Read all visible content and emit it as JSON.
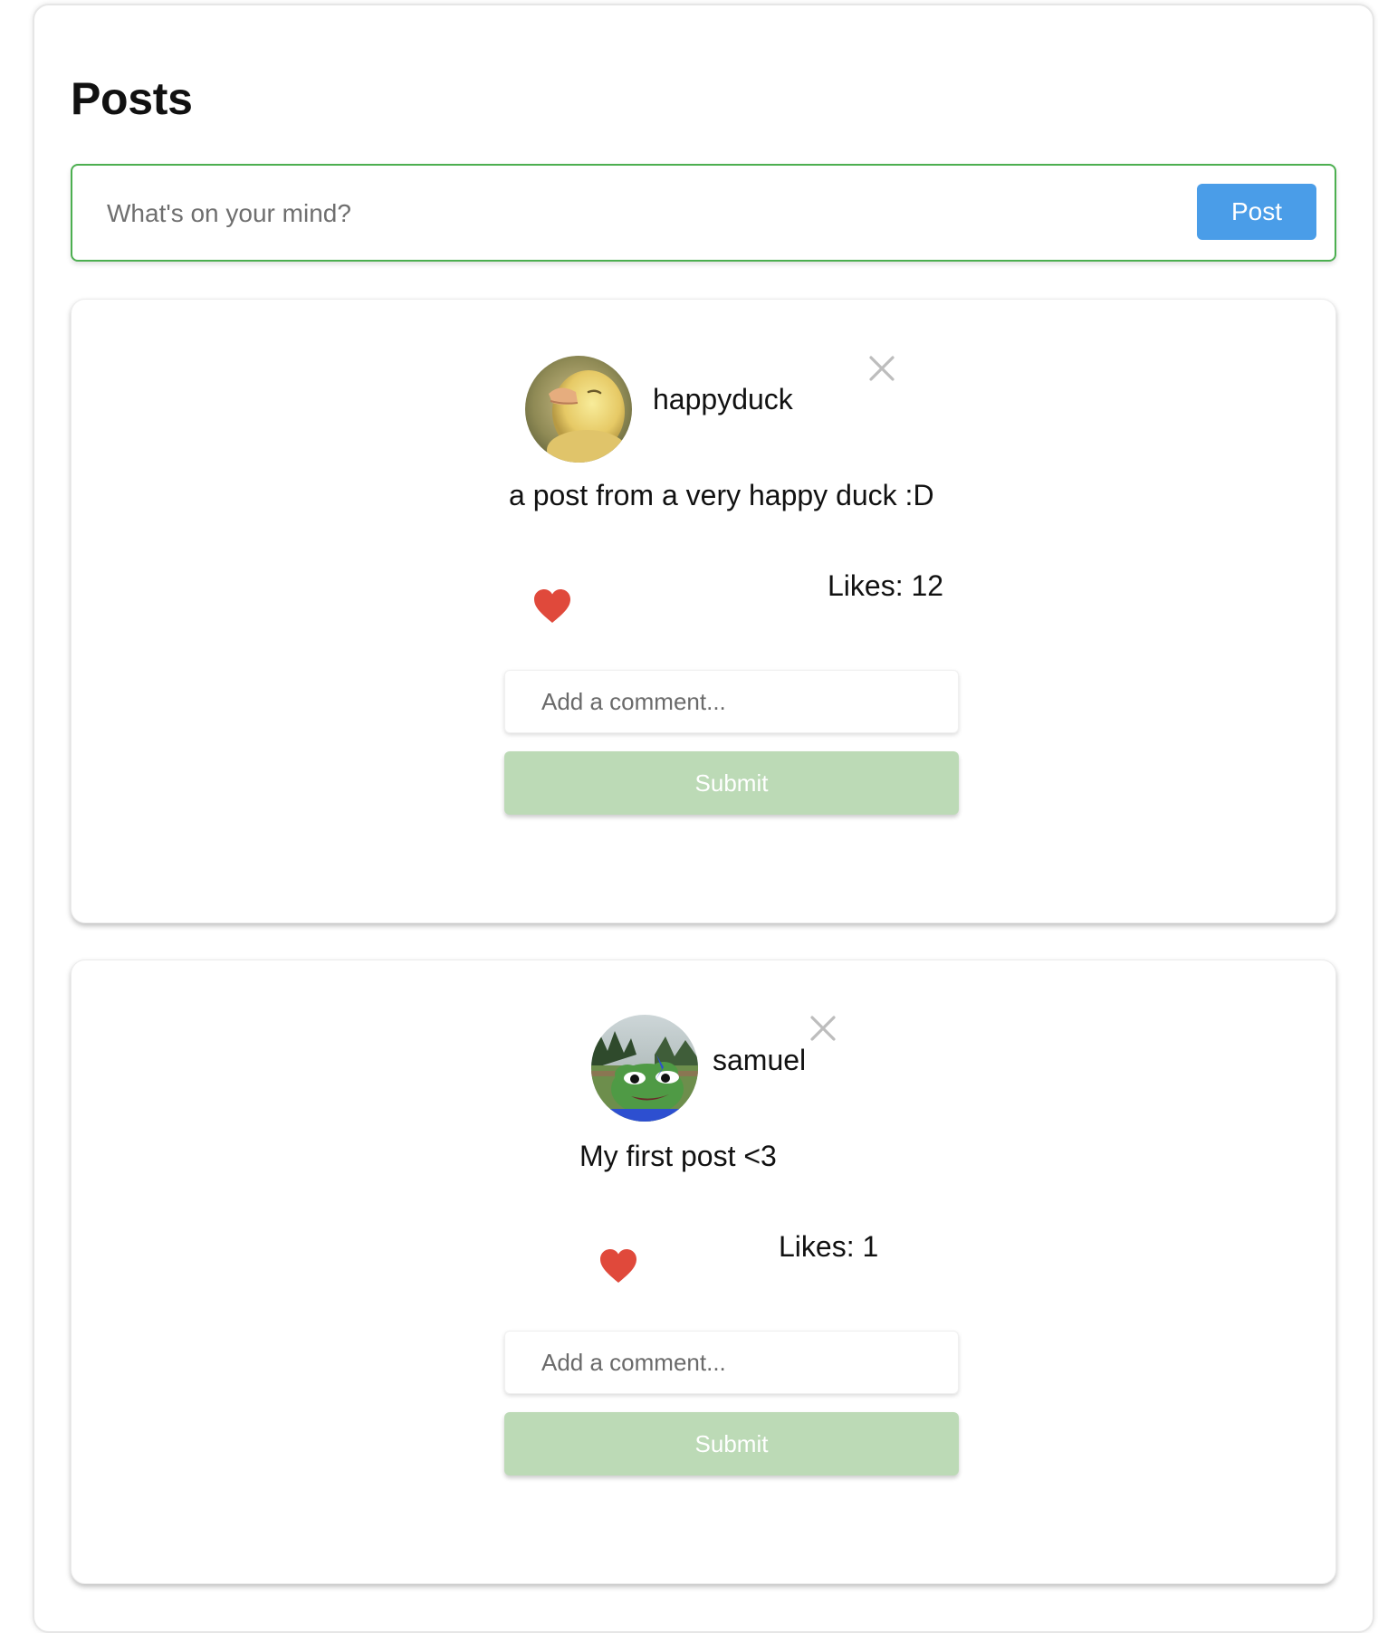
{
  "page": {
    "title": "Posts"
  },
  "composer": {
    "placeholder": "What's on your mind?",
    "post_label": "Post"
  },
  "posts": [
    {
      "username": "happyduck",
      "content": "a post from a very happy duck :D",
      "likes_label": "Likes: ",
      "likes_count": "12",
      "comment_placeholder": "Add a comment...",
      "submit_label": "Submit"
    },
    {
      "username": "samuel",
      "content": "My first post <3",
      "likes_label": "Likes: ",
      "likes_count": "1",
      "comment_placeholder": "Add a comment...",
      "submit_label": "Submit"
    }
  ],
  "icons": {
    "like": "heart-icon",
    "delete": "close-icon"
  },
  "colors": {
    "composer_border": "#4caf50",
    "post_button": "#4a9de8",
    "submit_button": "#bcdab6",
    "heart": "#e0493b",
    "close_icon": "#bdbdbd"
  }
}
